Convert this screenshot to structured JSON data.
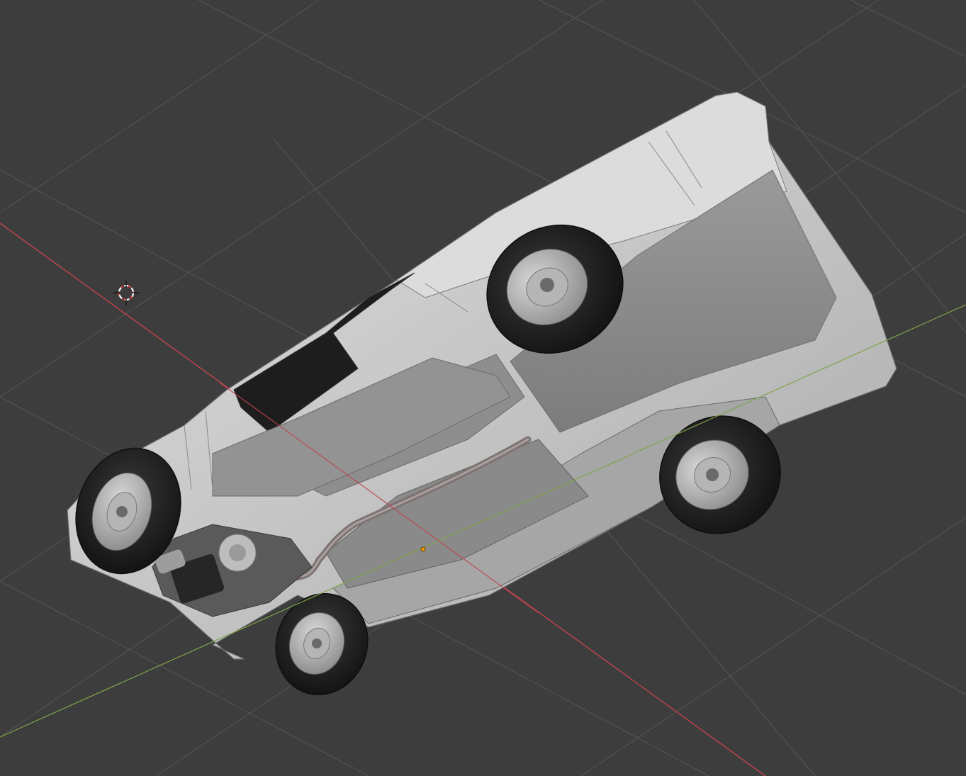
{
  "app": {
    "name": "",
    "view": "3D Viewport"
  },
  "viewport": {
    "background_color": "#3d3d3d",
    "grid_color": "#565656",
    "x_axis_color": "#c0444e",
    "y_axis_color": "#7fa548",
    "origin_color": "#ff9900",
    "cursor_color": "#d0383b"
  },
  "scene": {
    "object": "car-body-upside-down",
    "wheels": 4,
    "body_color": "#cfcfcf",
    "tire_color": "#1c1c1c"
  }
}
